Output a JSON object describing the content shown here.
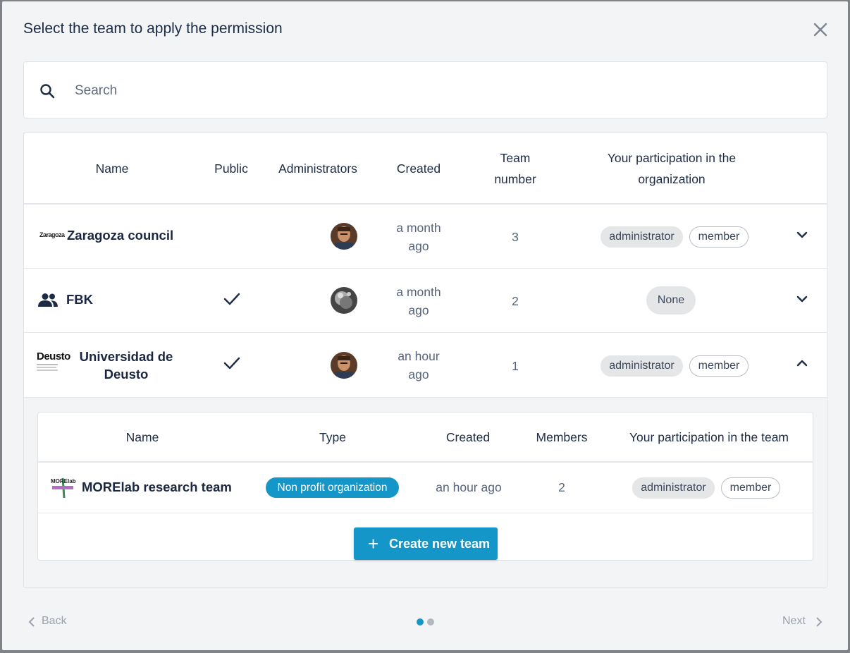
{
  "dialog": {
    "title": "Select the team to apply the permission"
  },
  "search": {
    "placeholder": "Search"
  },
  "table": {
    "headers": {
      "name": "Name",
      "public": "Public",
      "administrators": "Administrators",
      "created": "Created",
      "team_number_line1": "Team",
      "team_number_line2": "number",
      "participation_line1": "Your participation in the",
      "participation_line2": "organization"
    },
    "rows": [
      {
        "logo": "Zaragoza",
        "name": "Zaragoza council",
        "public": false,
        "created_line1": "a month",
        "created_line2": "ago",
        "team_number": "3",
        "participation": [
          "administrator",
          "member"
        ],
        "expanded": false
      },
      {
        "logo_icon": "group-icon",
        "name": "FBK",
        "public": true,
        "created_line1": "a month",
        "created_line2": "ago",
        "team_number": "2",
        "participation": [
          "None"
        ],
        "expanded": false
      },
      {
        "logo": "Deusto",
        "name_line1": "Universidad de",
        "name_line2": "Deusto",
        "public": true,
        "created_line1": "an hour",
        "created_line2": "ago",
        "team_number": "1",
        "participation": [
          "administrator",
          "member"
        ],
        "expanded": true
      }
    ]
  },
  "teams": {
    "headers": {
      "name": "Name",
      "type": "Type",
      "created": "Created",
      "members": "Members",
      "participation": "Your participation in the team"
    },
    "rows": [
      {
        "logo": "MORElab",
        "name": "MORElab research team",
        "type": "Non profit organization",
        "created": "an hour ago",
        "members": "2",
        "participation": [
          "administrator",
          "member"
        ]
      }
    ],
    "create_button": "Create new team"
  },
  "footer": {
    "back": "Back",
    "next": "Next",
    "page_count": 2,
    "current_page": 1
  },
  "colors": {
    "accent": "#1596c9",
    "text": "#1d2b45",
    "chip_bg": "#e5e6e8"
  }
}
